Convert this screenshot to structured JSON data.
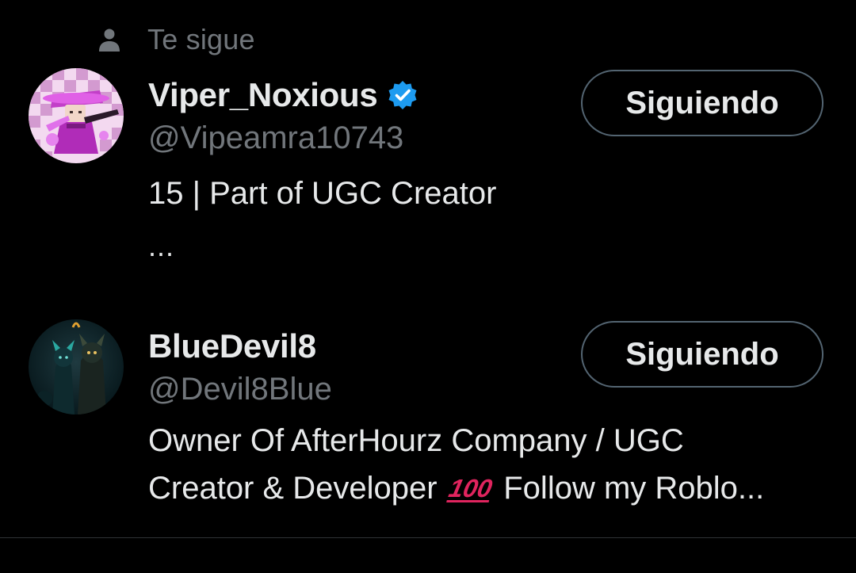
{
  "follows_you": {
    "icon": "person-icon",
    "label": "Te sigue"
  },
  "users": [
    {
      "display_name": "Viper_Noxious",
      "verified": true,
      "verified_icon": "verified-badge-icon",
      "handle": "@Vipeamra10743",
      "bio": "15 | Part of UGC Creator",
      "bio_more": "...",
      "follow_button": "Siguiendo"
    },
    {
      "display_name": "BlueDevil8",
      "verified": false,
      "handle": "@Devil8Blue",
      "bio_line1": "Owner Of AfterHourz Company / UGC",
      "bio_line2_before": "Creator & Developer",
      "bio_emoji": "💯",
      "bio_line2_after": "Follow my Roblo...",
      "follow_button": "Siguiendo"
    }
  ],
  "colors": {
    "background": "#000000",
    "primary_text": "#e7e9ea",
    "secondary_text": "#71767b",
    "button_border": "#536471",
    "verified_blue": "#1d9bf0",
    "divider": "#2f3336"
  }
}
